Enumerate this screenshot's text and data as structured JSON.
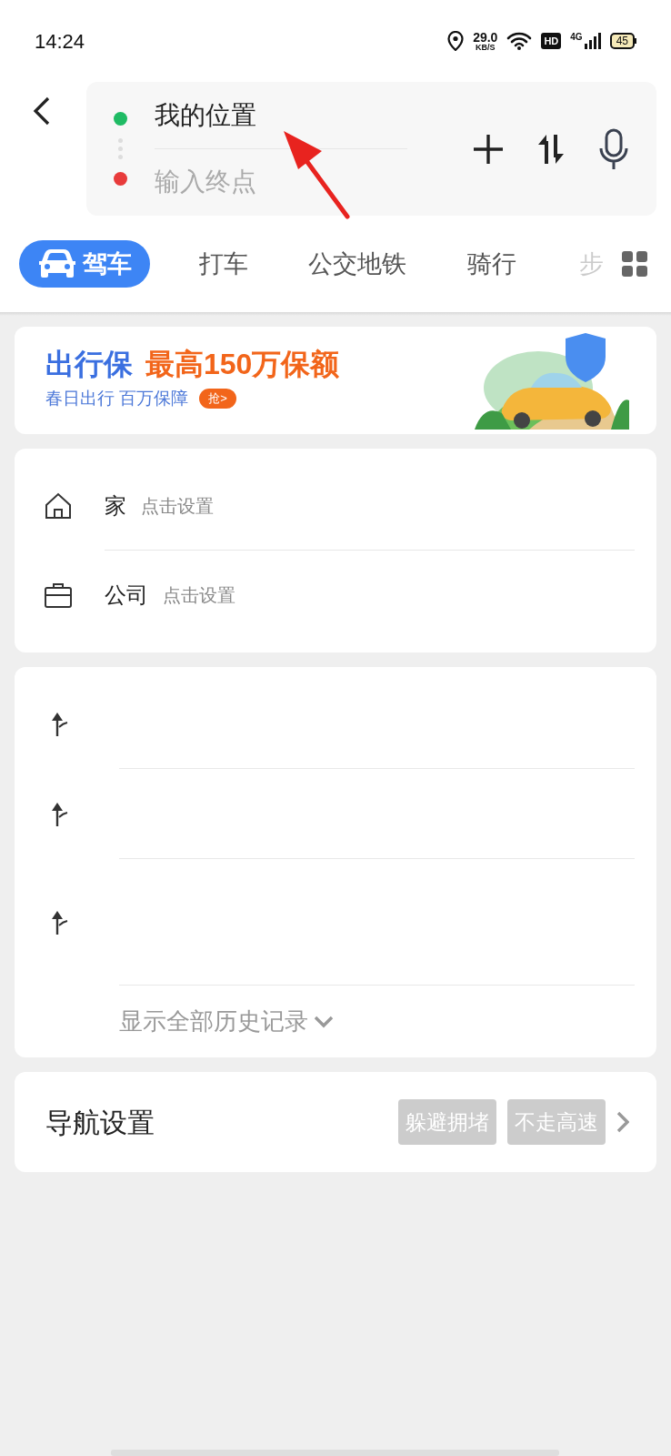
{
  "status_bar": {
    "time": "14:24",
    "net_speed": "29.0",
    "net_speed_unit": "KB/S",
    "hd": "HD",
    "network": "4G",
    "battery": "45"
  },
  "route": {
    "start": "我的位置",
    "end_placeholder": "输入终点"
  },
  "tabs": [
    {
      "label": "驾车",
      "selected": true,
      "faded": false
    },
    {
      "label": "打车",
      "selected": false,
      "faded": false
    },
    {
      "label": "公交地铁",
      "selected": false,
      "faded": false
    },
    {
      "label": "骑行",
      "selected": false,
      "faded": false
    },
    {
      "label": "步",
      "selected": false,
      "faded": true
    }
  ],
  "banner": {
    "title": "出行保",
    "highlight": "最高150万保额",
    "subtitle": "春日出行 百万保障",
    "button": "抢>"
  },
  "places": [
    {
      "kind": "home",
      "label": "家",
      "hint": "点击设置"
    },
    {
      "kind": "work",
      "label": "公司",
      "hint": "点击设置"
    }
  ],
  "history": {
    "rows": [
      {
        "kind": "route"
      },
      {
        "kind": "route"
      },
      {
        "kind": "route"
      }
    ],
    "show_all": "显示全部历史记录"
  },
  "nav_settings": {
    "title": "导航设置",
    "tags": [
      "躲避拥堵",
      "不走高速"
    ]
  }
}
